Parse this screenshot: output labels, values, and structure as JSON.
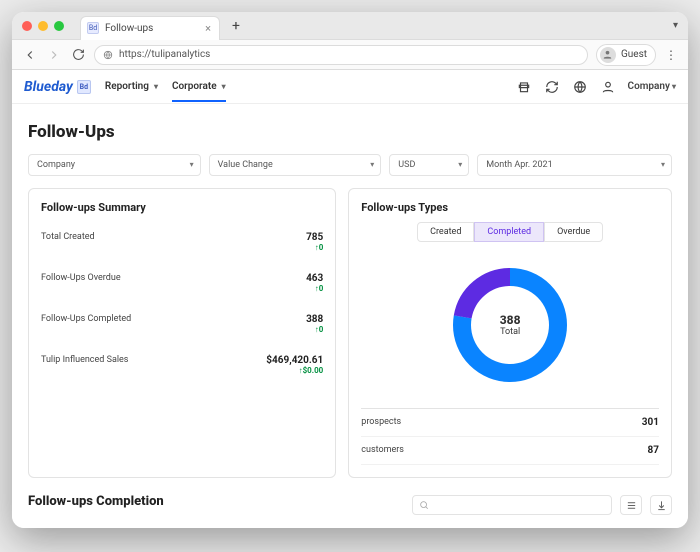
{
  "browser": {
    "tab_title": "Follow-ups",
    "favicon_letters": "Bd",
    "url": "https://tulipanalytics",
    "profile_label": "Guest"
  },
  "header": {
    "brand": "Blueday",
    "brand_badge": "Bd",
    "nav": {
      "reporting": "Reporting",
      "corporate": "Corporate"
    },
    "company_dd": "Company"
  },
  "page_title": "Follow-Ups",
  "filters": {
    "company": "Company",
    "metric": "Value Change",
    "currency": "USD",
    "period": "Month Apr. 2021"
  },
  "summary_card": {
    "title": "Follow-ups Summary",
    "rows": [
      {
        "label": "Total Created",
        "value": "785",
        "delta": "↑0"
      },
      {
        "label": "Follow-Ups Overdue",
        "value": "463",
        "delta": "↑0"
      },
      {
        "label": "Follow-Ups Completed",
        "value": "388",
        "delta": "↑0"
      },
      {
        "label": "Tulip Influenced Sales",
        "value": "$469,420.61",
        "delta": "↑$0.00"
      }
    ]
  },
  "types_card": {
    "title": "Follow-ups Types",
    "tabs": {
      "created": "Created",
      "completed": "Completed",
      "overdue": "Overdue"
    },
    "active_tab": "completed",
    "donut_center_value": "388",
    "donut_center_label": "Total",
    "legend": [
      {
        "label": "prospects",
        "value": "301"
      },
      {
        "label": "customers",
        "value": "87"
      }
    ]
  },
  "completion_section": {
    "title": "Follow-ups Completion",
    "search_placeholder": ""
  },
  "chart_data": {
    "type": "pie",
    "title": "Follow-ups Types — Completed",
    "total": 388,
    "series": [
      {
        "name": "prospects",
        "values": [
          301
        ],
        "color": "#0a84ff"
      },
      {
        "name": "customers",
        "values": [
          87
        ],
        "color": "#5d2be2"
      }
    ]
  }
}
